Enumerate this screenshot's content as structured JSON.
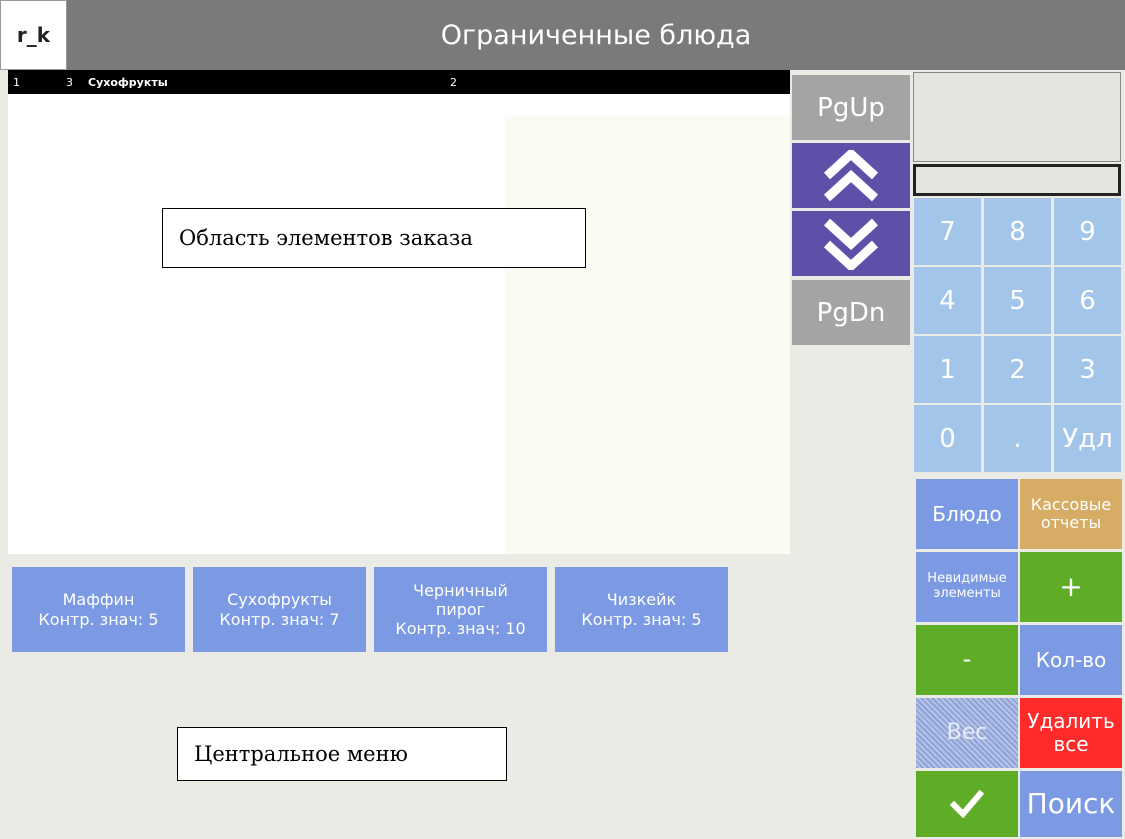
{
  "header": {
    "logo": "r_k",
    "title": "Ограниченные блюда"
  },
  "order_header": {
    "col1": "1",
    "col2": "3",
    "item": "Сухофрукты",
    "qty": "2"
  },
  "callouts": {
    "order_area": "Область элементов заказа",
    "central_menu": "Центральное меню"
  },
  "scroll": {
    "pgup": "PgUp",
    "up_icon": "double-chevron-up-icon",
    "down_icon": "double-chevron-down-icon",
    "pgdn": "PgDn"
  },
  "keypad": [
    "7",
    "8",
    "9",
    "4",
    "5",
    "6",
    "1",
    "2",
    "3",
    "0",
    ".",
    "Удл"
  ],
  "functions": {
    "dish": "Блюдо",
    "cash_reports": "Кассовые отчеты",
    "invisible_items": "Невидимые элементы",
    "plus": "+",
    "minus": "-",
    "qty": "Кол-во",
    "weight": "Вес",
    "delete_all": "Удалить все",
    "confirm_icon": "checkmark-icon",
    "search": "Поиск"
  },
  "menu_items": [
    {
      "name": "Маффин",
      "limit": "Контр. знач: 5"
    },
    {
      "name": "Сухофрукты",
      "limit": "Контр. знач: 7"
    },
    {
      "name": "Черничный пирог",
      "limit": "Контр. знач: 10"
    },
    {
      "name": "Чизкейк",
      "limit": "Контр. знач: 5"
    }
  ],
  "colors": {
    "header_bg": "#7a7a7a",
    "accent_purple": "#5e4fa8",
    "keypad_blue": "#a4c5ea",
    "menu_blue": "#7b9ae3",
    "green": "#5fad26",
    "red": "#ff2a2a",
    "tan": "#d7ad66"
  }
}
